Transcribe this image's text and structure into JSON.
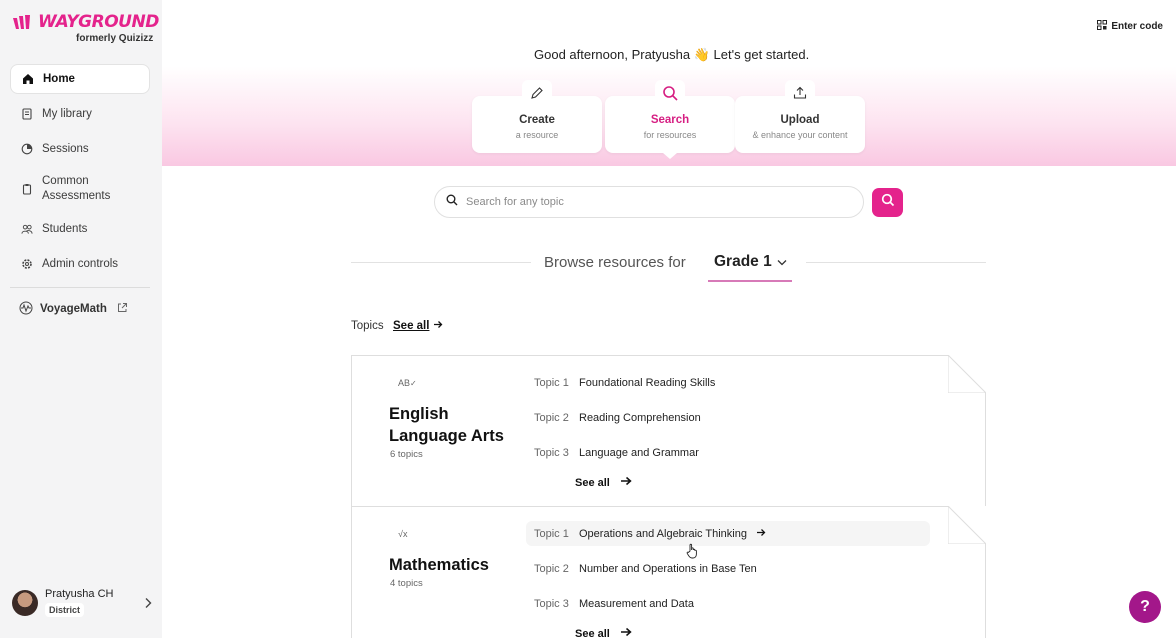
{
  "brand": {
    "name": "WAYGROUND",
    "sub": "formerly Quizizz",
    "color": "#e4238c"
  },
  "sidebar": {
    "items": [
      {
        "label": "Home",
        "icon": "home-icon",
        "active": true
      },
      {
        "label": "My library",
        "icon": "library-icon"
      },
      {
        "label": "Sessions",
        "icon": "sessions-icon"
      },
      {
        "label": "Common Assessments",
        "icon": "clipboard-icon"
      },
      {
        "label": "Students",
        "icon": "students-icon"
      },
      {
        "label": "Admin controls",
        "icon": "gear-icon"
      }
    ],
    "voyage": {
      "label": "VoyageMath",
      "icon": "external-link-icon"
    },
    "user": {
      "name": "Pratyusha CH",
      "role": "District"
    }
  },
  "header": {
    "enter_code": "Enter code",
    "greeting": "Good afternoon, Pratyusha 👋 Let's get started."
  },
  "actions": [
    {
      "title": "Create",
      "sub": "a resource",
      "icon": "pencil-icon"
    },
    {
      "title": "Search",
      "sub": "for resources",
      "icon": "search-icon",
      "selected": true
    },
    {
      "title": "Upload",
      "sub": "& enhance your content",
      "icon": "upload-icon"
    }
  ],
  "search": {
    "placeholder": "Search for any topic"
  },
  "browse": {
    "label": "Browse resources for",
    "grade": "Grade 1"
  },
  "topics": {
    "label": "Topics",
    "see_all": "See all"
  },
  "subjects": [
    {
      "icon_text": "AB",
      "title_line1": "English",
      "title_line2": "Language Arts",
      "count": "6 topics",
      "topics": [
        {
          "num": "Topic 1",
          "name": "Foundational Reading Skills"
        },
        {
          "num": "Topic 2",
          "name": "Reading Comprehension"
        },
        {
          "num": "Topic 3",
          "name": "Language and Grammar"
        }
      ],
      "see_all": "See all"
    },
    {
      "icon_text": "√x",
      "title_line1": "Mathematics",
      "count": "4 topics",
      "topics": [
        {
          "num": "Topic 1",
          "name": "Operations and Algebraic Thinking"
        },
        {
          "num": "Topic 2",
          "name": "Number and Operations in Base Ten"
        },
        {
          "num": "Topic 3",
          "name": "Measurement and Data"
        }
      ],
      "see_all": "See all"
    }
  ],
  "help": {
    "label": "?"
  }
}
